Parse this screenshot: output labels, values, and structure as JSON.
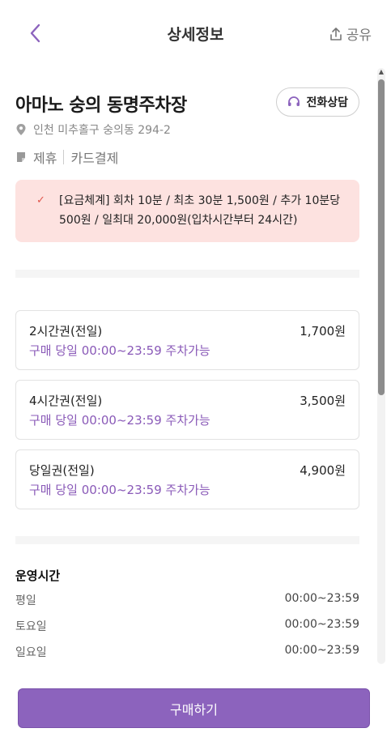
{
  "header": {
    "title": "상세정보",
    "share_label": "공유"
  },
  "lot": {
    "name": "아마노 숭의 동명주차장",
    "call_label": "전화상담",
    "address": "인천 미추홀구 숭의동 294-2",
    "tags": [
      "제휴",
      "카드결제"
    ]
  },
  "fee": {
    "line1": "[요금체계] 회차 10분 / 최초 30분 1,500원 / 추가 10분당",
    "line2": "500원 / 일최대 20,000원(입차시간부터 24시간)"
  },
  "tickets": [
    {
      "name": "2시간권(전일)",
      "price": "1,700원",
      "note": "구매 당일 00:00~23:59 주차가능"
    },
    {
      "name": "4시간권(전일)",
      "price": "3,500원",
      "note": "구매 당일 00:00~23:59 주차가능"
    },
    {
      "name": "당일권(전일)",
      "price": "4,900원",
      "note": "구매 당일 00:00~23:59 주차가능"
    }
  ],
  "hours": {
    "title": "운영시간",
    "rows": [
      {
        "label": "평일",
        "value": "00:00~23:59"
      },
      {
        "label": "토요일",
        "value": "00:00~23:59"
      },
      {
        "label": "일요일",
        "value": "00:00~23:59"
      }
    ]
  },
  "footer": {
    "buy_label": "구매하기"
  },
  "colors": {
    "accent": "#8c63bd",
    "fee_bg": "#fde2e0",
    "fee_check": "#e0564c"
  },
  "icons": [
    "chevron-left-icon",
    "share-icon",
    "headset-icon",
    "location-pin-icon",
    "tag-icon",
    "check-icon"
  ]
}
